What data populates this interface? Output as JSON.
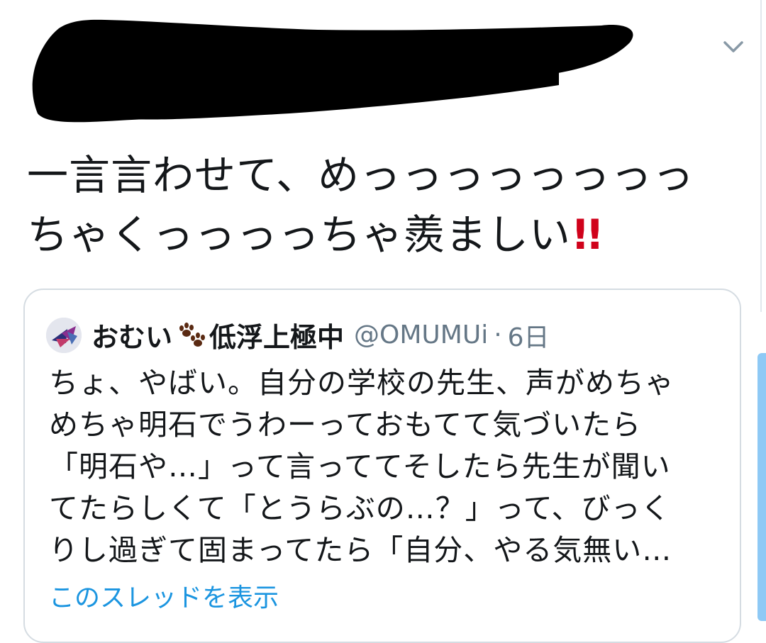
{
  "tweet": {
    "text_main": "一言言わせて、めっっっっっっっっ\nちゃくっっっっちゃ羨ましい",
    "emoji_icon": "double-exclamation-icon",
    "menu_icon": "chevron-down-icon"
  },
  "quoted": {
    "display_name": "おむい",
    "display_name_rest": "低浮上極中",
    "name_icon": "paw-prints-icon",
    "handle": "@OMUMUi",
    "separator": "·",
    "time": "6日",
    "text": "ちょ、やばい。自分の学校の先生、声がめちゃ\nめちゃ明石でうわーっておもてて気づいたら\n「明石や…」って言っててそしたら先生が聞い\nてたらしくて「とうらぶの…？」って、びっく\nりし過ぎて固まってたら「自分、やる気無い…",
    "show_thread": "このスレッドを表示"
  },
  "colors": {
    "link": "#1b95e0",
    "muted": "#657786",
    "exclamation": "#d0021b"
  }
}
